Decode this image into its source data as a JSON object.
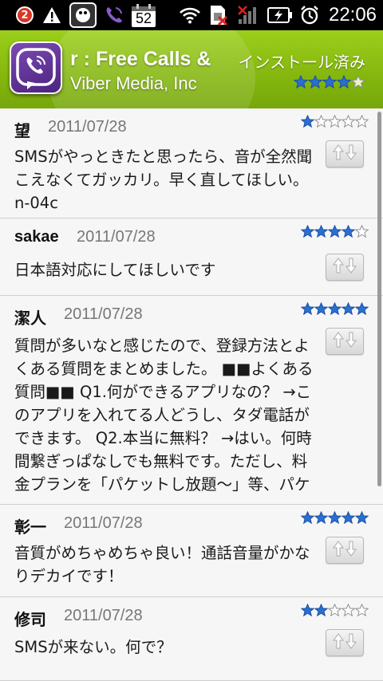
{
  "status_bar": {
    "notification_count": "2",
    "calendar_day": "52",
    "time": "22:06"
  },
  "app": {
    "title": "r : Free Calls &",
    "developer": "Viber Media, Inc",
    "install_status": "インストール済み",
    "rating": 4,
    "rating_max": 5
  },
  "colors": {
    "header_green": "#86b810",
    "star_blue": "#2a6fd1",
    "app_purple": "#5d2f95"
  },
  "reviews": [
    {
      "author": "望",
      "date": "2011/07/28",
      "rating": 1,
      "text": "SMSがやっときたと思ったら、音が全然聞こえなくてガッカリ。早く直してほしい。 n-04c"
    },
    {
      "author": "sakae",
      "date": "2011/07/28",
      "rating": 4,
      "text": "日本語対応にしてほしいです"
    },
    {
      "author": "潔人",
      "date": "2011/07/28",
      "rating": 5,
      "text": "質問が多いなと感じたので、登録方法とよくある質問をまとめました。 ■■よくある質問■■ Q1.何ができるアプリなの？ →このアプリを入れてる人どうし、タダ電話ができます。 Q2.本当に無料？ →はい。何時間繋ぎっぱなしでも無料です。ただし、料金プランを「パケットし放題〜」等、パケット通信を定"
    },
    {
      "author": "彰一",
      "date": "2011/07/28",
      "rating": 5,
      "text": "音質がめちゃめちゃ良い！通話音量がかなりデカイです！"
    },
    {
      "author": "修司",
      "date": "2011/07/28",
      "rating": 2,
      "text": "SMSが来ない。何で？"
    }
  ]
}
